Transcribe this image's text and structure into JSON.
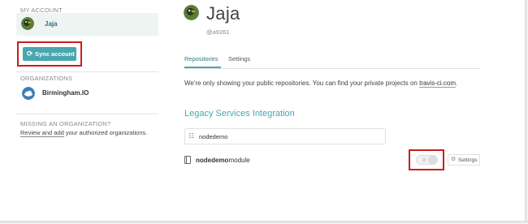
{
  "sidebar": {
    "my_account_title": "MY ACCOUNT",
    "account_name": "Jaja",
    "sync_button": {
      "label": "Sync account",
      "icon": "sync-icon"
    },
    "organizations_title": "ORGANIZATIONS",
    "organizations": [
      {
        "name": "Birmingham.IO",
        "icon": "cloud-icon"
      }
    ],
    "missing_title": "MISSING AN ORGANIZATION?",
    "missing_link_underlined": "Review and add",
    "missing_link_rest": " your authorized organizations."
  },
  "profile": {
    "name": "Jaja",
    "handle": "@a9261"
  },
  "tabs": [
    {
      "label": "Repositories",
      "active": true
    },
    {
      "label": "Settings",
      "active": false
    }
  ],
  "info": {
    "text": "We're only showing your public repositories. You can find your private projects on ",
    "link": "travis-ci.com",
    "suffix": "."
  },
  "legacy": {
    "title": "Legacy Services Integration",
    "filter_value": "nodedemo",
    "repos": [
      {
        "name_match": "nodedemo",
        "name_rest": "module",
        "enabled": false,
        "settings_label": "Settings"
      }
    ]
  },
  "colors": {
    "accent": "#4aa6ae",
    "highlight_box": "#cc1d1d",
    "account_row_bg": "#eef4f2"
  }
}
